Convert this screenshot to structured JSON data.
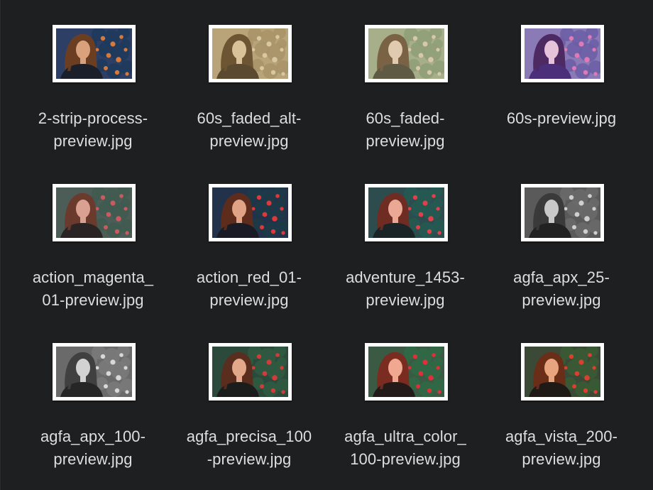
{
  "files": [
    {
      "name_line1": "2-strip-process-",
      "name_line2": "preview.jpg",
      "tone": {
        "bg": "#2e3f66",
        "leaf": "#1d3a5c",
        "flower": "#d6793a",
        "hair": "#6b3e22",
        "skin": "#d9a27c",
        "shirt": "#1b1f2a"
      }
    },
    {
      "name_line1": "60s_faded_alt-",
      "name_line2": "preview.jpg",
      "tone": {
        "bg": "#b9a47a",
        "leaf": "#a89367",
        "flower": "#d8c8a2",
        "hair": "#6d5533",
        "skin": "#d9c19a",
        "shirt": "#5b4a30"
      }
    },
    {
      "name_line1": "60s_faded-",
      "name_line2": "preview.jpg",
      "tone": {
        "bg": "#a7ae8a",
        "leaf": "#8f9f78",
        "flower": "#d7c9a7",
        "hair": "#7a6345",
        "skin": "#e0cbb0",
        "shirt": "#5e5a44"
      }
    },
    {
      "name_line1": "60s-preview.jpg",
      "name_line2": "",
      "tone": {
        "bg": "#8a7bb6",
        "leaf": "#6b5ea6",
        "flower": "#e07ab4",
        "hair": "#4e2a63",
        "skin": "#e6c3d8",
        "shirt": "#4b2f7a"
      }
    },
    {
      "name_line1": "action_magenta_",
      "name_line2": "01-preview.jpg",
      "tone": {
        "bg": "#4c5d58",
        "leaf": "#3f5a50",
        "flower": "#c95a5f",
        "hair": "#6a3a2d",
        "skin": "#d9a190",
        "shirt": "#2a2424"
      }
    },
    {
      "name_line1": "action_red_01-",
      "name_line2": "preview.jpg",
      "tone": {
        "bg": "#22324a",
        "leaf": "#1c3b46",
        "flower": "#e0383a",
        "hair": "#5e2c1c",
        "skin": "#e0a385",
        "shirt": "#1a1b24"
      }
    },
    {
      "name_line1": "adventure_1453-",
      "name_line2": "preview.jpg",
      "tone": {
        "bg": "#2d4c4e",
        "leaf": "#255a52",
        "flower": "#e0404a",
        "hair": "#6e2c22",
        "skin": "#eba895",
        "shirt": "#1b2426"
      }
    },
    {
      "name_line1": "agfa_apx_25-",
      "name_line2": "preview.jpg",
      "tone": {
        "bg": "#5a5a5a",
        "leaf": "#6b6b6b",
        "flower": "#cfcfcf",
        "hair": "#3a3a3a",
        "skin": "#c9c9c9",
        "shirt": "#222222"
      }
    },
    {
      "name_line1": "agfa_apx_100-",
      "name_line2": "preview.jpg",
      "tone": {
        "bg": "#6a6a6a",
        "leaf": "#7a7a7a",
        "flower": "#d8d8d8",
        "hair": "#404040",
        "skin": "#d2d2d2",
        "shirt": "#262626"
      }
    },
    {
      "name_line1": "agfa_precisa_100",
      "name_line2": "-preview.jpg",
      "tone": {
        "bg": "#2c4a3c",
        "leaf": "#2f5a40",
        "flower": "#d33a3a",
        "hair": "#5a2e1e",
        "skin": "#e2a889",
        "shirt": "#1b1d1c"
      }
    },
    {
      "name_line1": "agfa_ultra_color_",
      "name_line2": "100-preview.jpg",
      "tone": {
        "bg": "#3a5a44",
        "leaf": "#2f6a44",
        "flower": "#e02f3a",
        "hair": "#7a2c20",
        "skin": "#f0a890",
        "shirt": "#241a1a"
      }
    },
    {
      "name_line1": "agfa_vista_200-",
      "name_line2": "preview.jpg",
      "tone": {
        "bg": "#3a4a36",
        "leaf": "#3a5a34",
        "flower": "#d9402f",
        "hair": "#6a2e18",
        "skin": "#e8a47e",
        "shirt": "#1f1a16"
      }
    }
  ]
}
